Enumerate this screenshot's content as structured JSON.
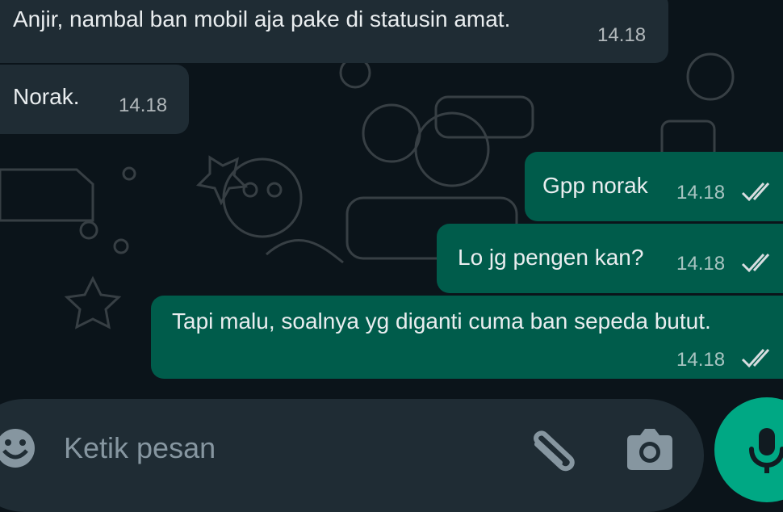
{
  "colors": {
    "background": "#0b141a",
    "incoming_bubble": "#1f2c34",
    "outgoing_bubble": "#005c4b",
    "tick_read": "#d8dde0",
    "mic_button": "#00a884"
  },
  "messages": [
    {
      "direction": "incoming",
      "text": "Anjir, nambal ban mobil aja pake di statusin amat.",
      "time": "14.18"
    },
    {
      "direction": "incoming",
      "text": "Norak.",
      "time": "14.18"
    },
    {
      "direction": "outgoing",
      "text": "Gpp norak",
      "time": "14.18",
      "status_icon": "double-check-icon"
    },
    {
      "direction": "outgoing",
      "text": "Lo jg pengen kan?",
      "time": "14.18",
      "status_icon": "double-check-icon"
    },
    {
      "direction": "outgoing",
      "text": "Tapi malu, soalnya yg diganti cuma ban sepeda butut.",
      "time": "14.18",
      "status_icon": "double-check-icon"
    }
  ],
  "composer": {
    "placeholder": "Ketik pesan",
    "value": "",
    "icons": [
      "emoji-icon",
      "paperclip-icon",
      "camera-icon",
      "microphone-icon"
    ]
  }
}
